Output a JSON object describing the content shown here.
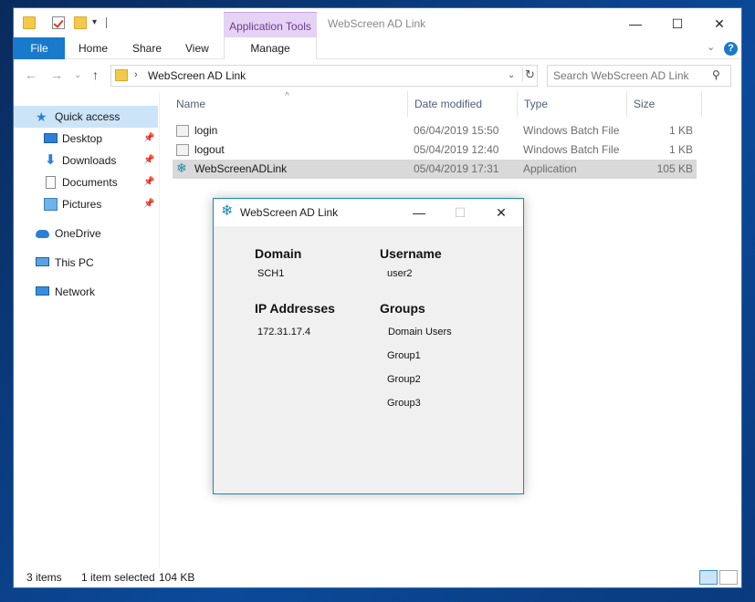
{
  "window": {
    "title": "WebScreen AD Link",
    "context_tab": "Application Tools",
    "minimize": "—",
    "maximize": "☐",
    "close": "✕"
  },
  "ribbon": {
    "tabs": [
      "File",
      "Home",
      "Share",
      "View",
      "Manage"
    ],
    "help": "?"
  },
  "address": {
    "path": "WebScreen AD Link",
    "search_placeholder": "Search WebScreen AD Link"
  },
  "nav": {
    "items": [
      {
        "label": "Quick access",
        "icon": "star-icon"
      },
      {
        "label": "Desktop",
        "icon": "desktop-icon"
      },
      {
        "label": "Downloads",
        "icon": "download-icon"
      },
      {
        "label": "Documents",
        "icon": "document-icon"
      },
      {
        "label": "Pictures",
        "icon": "pictures-icon"
      },
      {
        "label": "OneDrive",
        "icon": "cloud-icon"
      },
      {
        "label": "This PC",
        "icon": "computer-icon"
      },
      {
        "label": "Network",
        "icon": "network-icon"
      }
    ]
  },
  "columns": {
    "name": "Name",
    "date": "Date modified",
    "type": "Type",
    "size": "Size"
  },
  "files": [
    {
      "name": "login",
      "date": "06/04/2019 15:50",
      "type": "Windows Batch File",
      "size": "1 KB"
    },
    {
      "name": "logout",
      "date": "05/04/2019 12:40",
      "type": "Windows Batch File",
      "size": "1 KB"
    },
    {
      "name": "WebScreenADLink",
      "date": "05/04/2019 17:31",
      "type": "Application",
      "size": "105 KB"
    }
  ],
  "status": {
    "items": "3 items",
    "selected": "1 item selected",
    "size": "104 KB"
  },
  "dialog": {
    "title": "WebScreen AD Link",
    "domain_label": "Domain",
    "domain_value": "SCH1",
    "username_label": "Username",
    "username_value": "user2",
    "ip_label": "IP Addresses",
    "ip_value": "172.31.17.4",
    "groups_label": "Groups",
    "groups": [
      "Domain Users",
      "Group1",
      "Group2",
      "Group3"
    ]
  },
  "colors": {
    "accent": "#1979ca",
    "context_tab_bg": "#e6d2f5",
    "selection": "#cce4f7",
    "dialog_border": "#1e8aa8"
  }
}
